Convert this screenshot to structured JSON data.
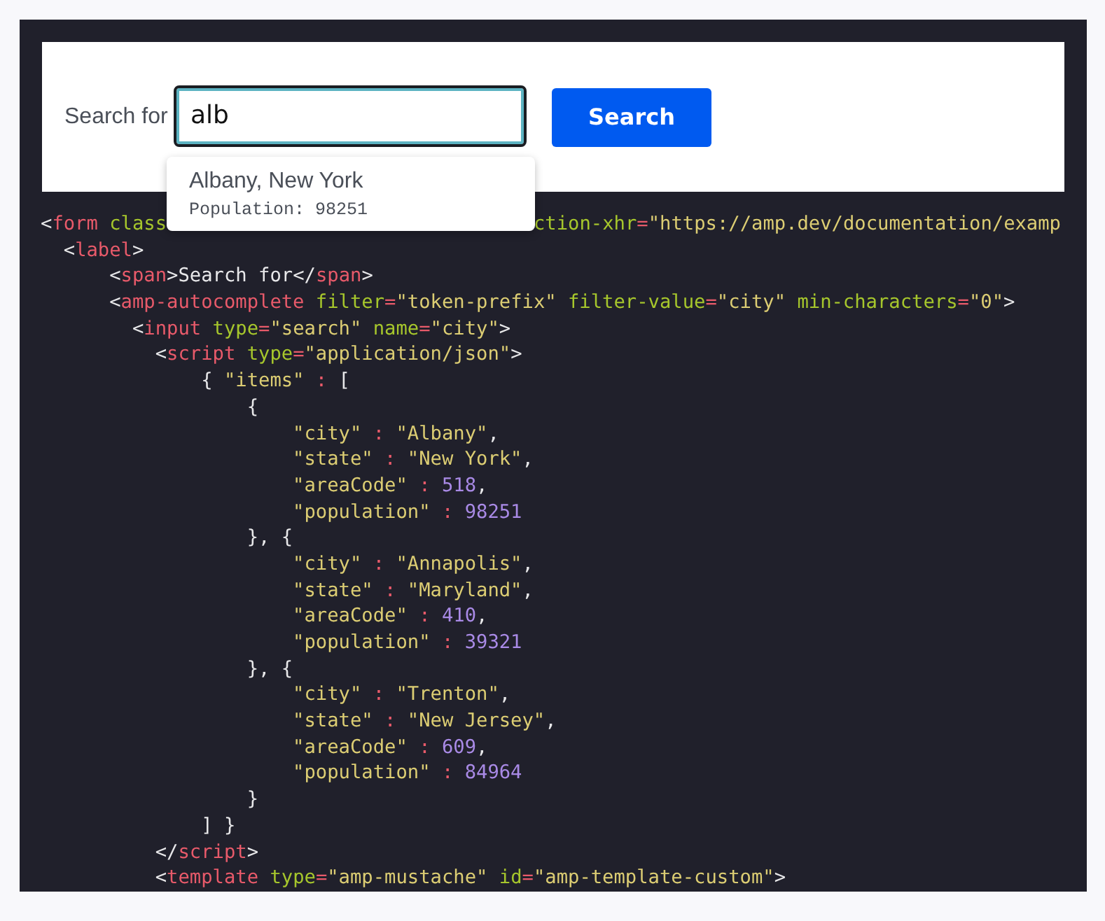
{
  "search_form": {
    "label": "Search for",
    "input": {
      "value": "alb"
    },
    "button": "Search"
  },
  "autocomplete": {
    "items": [
      {
        "title": "Albany, New York",
        "detail": "Population: 98251"
      }
    ]
  },
  "code": {
    "lines": [
      {
        "segments": [
          [
            {
              "kind": "p",
              "text": "<"
            },
            {
              "kind": "tag",
              "text": "form"
            },
            {
              "kind": "attr",
              "text": " class"
            }
          ],
          [
            {
              "kind": "attr",
              "text": "ction-xhr"
            },
            {
              "kind": "op",
              "text": "="
            },
            {
              "kind": "str",
              "text": "\"https://amp.dev/documentation/examp"
            }
          ]
        ]
      },
      {
        "segments": [
          [
            {
              "kind": "p",
              "text": "  <"
            },
            {
              "kind": "tag",
              "text": "label"
            },
            {
              "kind": "p",
              "text": ">"
            }
          ]
        ]
      },
      {
        "segments": [
          [
            {
              "kind": "p",
              "text": "      <"
            },
            {
              "kind": "tag",
              "text": "span"
            },
            {
              "kind": "p",
              "text": ">Search for</"
            },
            {
              "kind": "tag",
              "text": "span"
            },
            {
              "kind": "p",
              "text": ">"
            }
          ]
        ]
      },
      {
        "segments": [
          [
            {
              "kind": "p",
              "text": "      <"
            },
            {
              "kind": "tag",
              "text": "amp-autocomplete"
            },
            {
              "kind": "attr",
              "text": " filter"
            },
            {
              "kind": "op",
              "text": "="
            },
            {
              "kind": "str",
              "text": "\"token-prefix\""
            },
            {
              "kind": "attr",
              "text": " filter-value"
            },
            {
              "kind": "op",
              "text": "="
            },
            {
              "kind": "str",
              "text": "\"city\""
            },
            {
              "kind": "attr",
              "text": " min-characters"
            },
            {
              "kind": "op",
              "text": "="
            },
            {
              "kind": "str",
              "text": "\"0\""
            },
            {
              "kind": "p",
              "text": ">"
            }
          ]
        ]
      },
      {
        "segments": [
          [
            {
              "kind": "p",
              "text": "        <"
            },
            {
              "kind": "tag",
              "text": "input"
            },
            {
              "kind": "attr",
              "text": " type"
            },
            {
              "kind": "op",
              "text": "="
            },
            {
              "kind": "str",
              "text": "\"search\""
            },
            {
              "kind": "attr",
              "text": " name"
            },
            {
              "kind": "op",
              "text": "="
            },
            {
              "kind": "str",
              "text": "\"city\""
            },
            {
              "kind": "p",
              "text": ">"
            }
          ]
        ]
      },
      {
        "segments": [
          [
            {
              "kind": "p",
              "text": "          <"
            },
            {
              "kind": "tag",
              "text": "script"
            },
            {
              "kind": "attr",
              "text": " type"
            },
            {
              "kind": "op",
              "text": "="
            },
            {
              "kind": "str",
              "text": "\"application/json\""
            },
            {
              "kind": "p",
              "text": ">"
            }
          ]
        ]
      },
      {
        "segments": [
          [
            {
              "kind": "p",
              "text": "              { "
            },
            {
              "kind": "str",
              "text": "\"items\""
            },
            {
              "kind": "op",
              "text": " :"
            },
            {
              "kind": "p",
              "text": " ["
            }
          ]
        ]
      },
      {
        "segments": [
          [
            {
              "kind": "p",
              "text": "                  {"
            }
          ]
        ]
      },
      {
        "segments": [
          [
            {
              "kind": "str",
              "text": "                      \"city\""
            },
            {
              "kind": "op",
              "text": " :"
            },
            {
              "kind": "str",
              "text": " \"Albany\""
            },
            {
              "kind": "p",
              "text": ","
            }
          ]
        ]
      },
      {
        "segments": [
          [
            {
              "kind": "str",
              "text": "                      \"state\""
            },
            {
              "kind": "op",
              "text": " :"
            },
            {
              "kind": "str",
              "text": " \"New York\""
            },
            {
              "kind": "p",
              "text": ","
            }
          ]
        ]
      },
      {
        "segments": [
          [
            {
              "kind": "str",
              "text": "                      \"areaCode\""
            },
            {
              "kind": "op",
              "text": " :"
            },
            {
              "kind": "num",
              "text": " 518"
            },
            {
              "kind": "p",
              "text": ","
            }
          ]
        ]
      },
      {
        "segments": [
          [
            {
              "kind": "str",
              "text": "                      \"population\""
            },
            {
              "kind": "op",
              "text": " :"
            },
            {
              "kind": "num",
              "text": " 98251"
            }
          ]
        ]
      },
      {
        "segments": [
          [
            {
              "kind": "p",
              "text": "                  }, {"
            }
          ]
        ]
      },
      {
        "segments": [
          [
            {
              "kind": "str",
              "text": "                      \"city\""
            },
            {
              "kind": "op",
              "text": " :"
            },
            {
              "kind": "str",
              "text": " \"Annapolis\""
            },
            {
              "kind": "p",
              "text": ","
            }
          ]
        ]
      },
      {
        "segments": [
          [
            {
              "kind": "str",
              "text": "                      \"state\""
            },
            {
              "kind": "op",
              "text": " :"
            },
            {
              "kind": "str",
              "text": " \"Maryland\""
            },
            {
              "kind": "p",
              "text": ","
            }
          ]
        ]
      },
      {
        "segments": [
          [
            {
              "kind": "str",
              "text": "                      \"areaCode\""
            },
            {
              "kind": "op",
              "text": " :"
            },
            {
              "kind": "num",
              "text": " 410"
            },
            {
              "kind": "p",
              "text": ","
            }
          ]
        ]
      },
      {
        "segments": [
          [
            {
              "kind": "str",
              "text": "                      \"population\""
            },
            {
              "kind": "op",
              "text": " :"
            },
            {
              "kind": "num",
              "text": " 39321"
            }
          ]
        ]
      },
      {
        "segments": [
          [
            {
              "kind": "p",
              "text": "                  }, {"
            }
          ]
        ]
      },
      {
        "segments": [
          [
            {
              "kind": "str",
              "text": "                      \"city\""
            },
            {
              "kind": "op",
              "text": " :"
            },
            {
              "kind": "str",
              "text": " \"Trenton\""
            },
            {
              "kind": "p",
              "text": ","
            }
          ]
        ]
      },
      {
        "segments": [
          [
            {
              "kind": "str",
              "text": "                      \"state\""
            },
            {
              "kind": "op",
              "text": " :"
            },
            {
              "kind": "str",
              "text": " \"New Jersey\""
            },
            {
              "kind": "p",
              "text": ","
            }
          ]
        ]
      },
      {
        "segments": [
          [
            {
              "kind": "str",
              "text": "                      \"areaCode\""
            },
            {
              "kind": "op",
              "text": " :"
            },
            {
              "kind": "num",
              "text": " 609"
            },
            {
              "kind": "p",
              "text": ","
            }
          ]
        ]
      },
      {
        "segments": [
          [
            {
              "kind": "str",
              "text": "                      \"population\""
            },
            {
              "kind": "op",
              "text": " :"
            },
            {
              "kind": "num",
              "text": " 84964"
            }
          ]
        ]
      },
      {
        "segments": [
          [
            {
              "kind": "p",
              "text": "                  }"
            }
          ]
        ]
      },
      {
        "segments": [
          [
            {
              "kind": "p",
              "text": "              ] }"
            }
          ]
        ]
      },
      {
        "segments": [
          [
            {
              "kind": "p",
              "text": "          </"
            },
            {
              "kind": "tag",
              "text": "script"
            },
            {
              "kind": "p",
              "text": ">"
            }
          ]
        ]
      },
      {
        "segments": [
          [
            {
              "kind": "p",
              "text": "          <"
            },
            {
              "kind": "tag",
              "text": "template"
            },
            {
              "kind": "attr",
              "text": " type"
            },
            {
              "kind": "op",
              "text": "="
            },
            {
              "kind": "str",
              "text": "\"amp-mustache\""
            },
            {
              "kind": "attr",
              "text": " id"
            },
            {
              "kind": "op",
              "text": "="
            },
            {
              "kind": "str",
              "text": "\"amp-template-custom\""
            },
            {
              "kind": "p",
              "text": ">"
            }
          ]
        ]
      }
    ]
  }
}
